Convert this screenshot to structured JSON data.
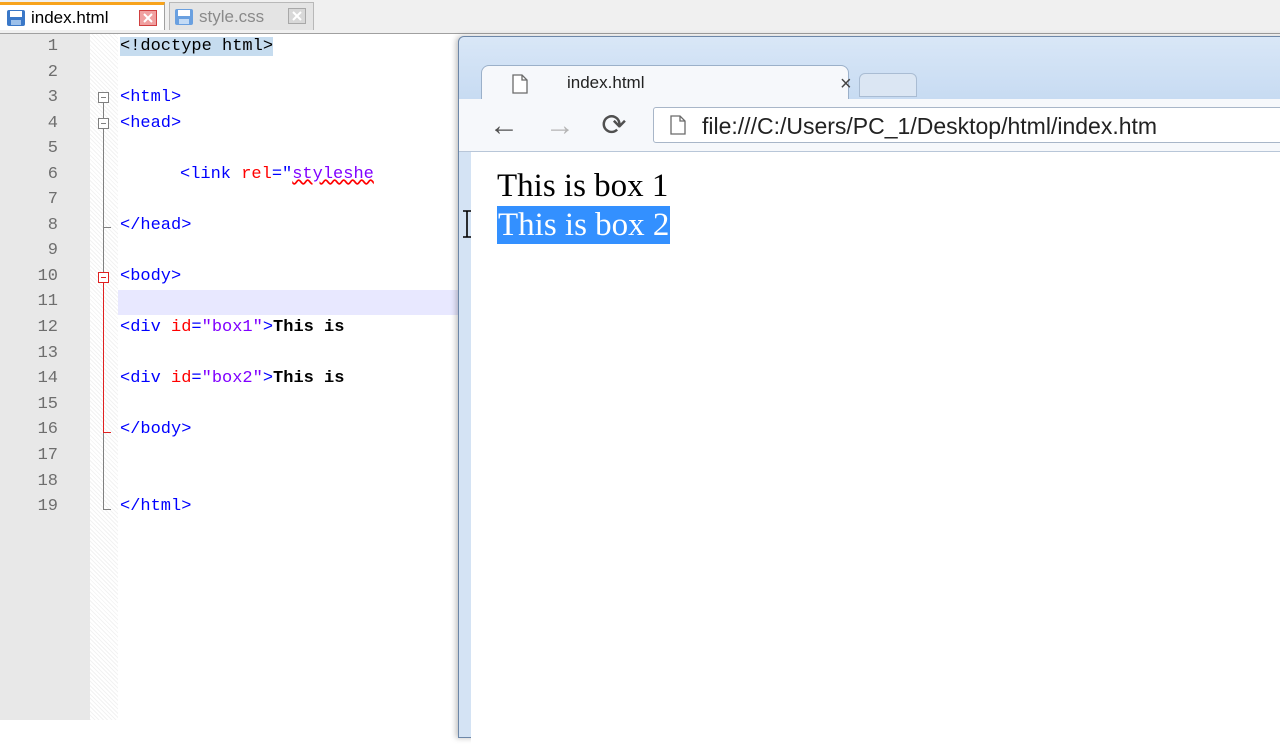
{
  "editor": {
    "tabs": [
      {
        "label": "index.html",
        "active": true
      },
      {
        "label": "style.css",
        "active": false
      }
    ],
    "line_numbers": [
      "1",
      "2",
      "3",
      "4",
      "5",
      "6",
      "7",
      "8",
      "9",
      "10",
      "11",
      "12",
      "13",
      "14",
      "15",
      "16",
      "17",
      "18",
      "19"
    ],
    "lines": {
      "l1": "<!doctype html>",
      "l3": "<html>",
      "l4": "<head>",
      "l6_tag": "<link ",
      "l6_attr": "rel",
      "l6_eq": "=\"",
      "l6_val": "styleshe",
      "l8": "</head>",
      "l10": "<body>",
      "l12_tag": "<div ",
      "l12_attr": "id",
      "l12_eq": "=",
      "l12_val": "\"box1\"",
      "l12_close": ">",
      "l12_text": "This is",
      "l14_tag": "<div ",
      "l14_attr": "id",
      "l14_eq": "=",
      "l14_val": "\"box2\"",
      "l14_close": ">",
      "l14_text": "This is",
      "l16": "</body>",
      "l19": "</html>"
    }
  },
  "browser": {
    "tab_title": "index.html",
    "tab_close": "×",
    "back_icon": "←",
    "forward_icon": "→",
    "reload_icon": "⟳",
    "url": "file:///C:/Users/PC_1/Desktop/html/index.htm",
    "page": {
      "box1": "This is box 1",
      "box2": "This is box 2"
    },
    "colors": {
      "selection": "#3390ff"
    }
  },
  "colors": {
    "tag": "#0000ff",
    "attr": "#ff0000",
    "value": "#8000ff",
    "active_tab_accent": "#f7a31c"
  }
}
